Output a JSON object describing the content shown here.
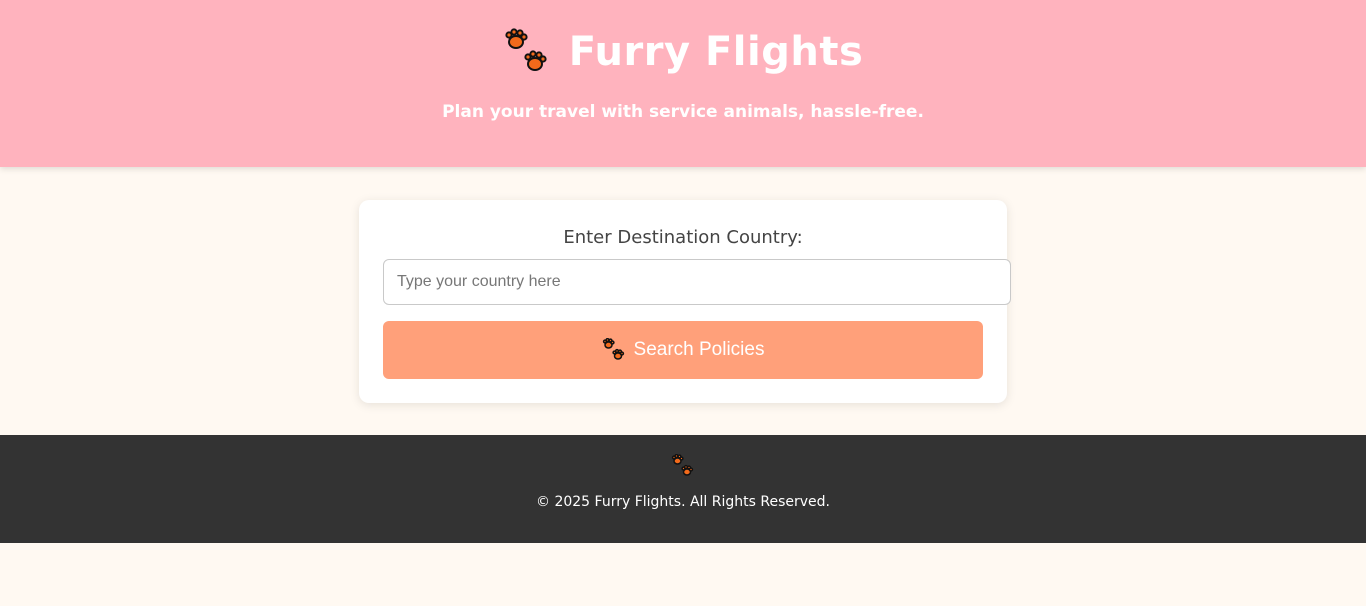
{
  "header": {
    "title": "Furry Flights",
    "subtitle": "Plan your travel with service animals, hassle-free.",
    "logo_icon": "paw-prints-icon"
  },
  "search": {
    "label": "Enter Destination Country:",
    "placeholder": "Type your country here",
    "value": "",
    "button_label": "Search Policies",
    "button_icon": "paw-prints-icon"
  },
  "footer": {
    "icon": "paw-prints-icon",
    "copyright": "© 2025 Furry Flights. All Rights Reserved."
  },
  "colors": {
    "header_bg": "#ffb3be",
    "page_bg": "#fff9f2",
    "button_bg": "#ffa07a",
    "footer_bg": "#333333",
    "paw": "#f26a1b"
  }
}
